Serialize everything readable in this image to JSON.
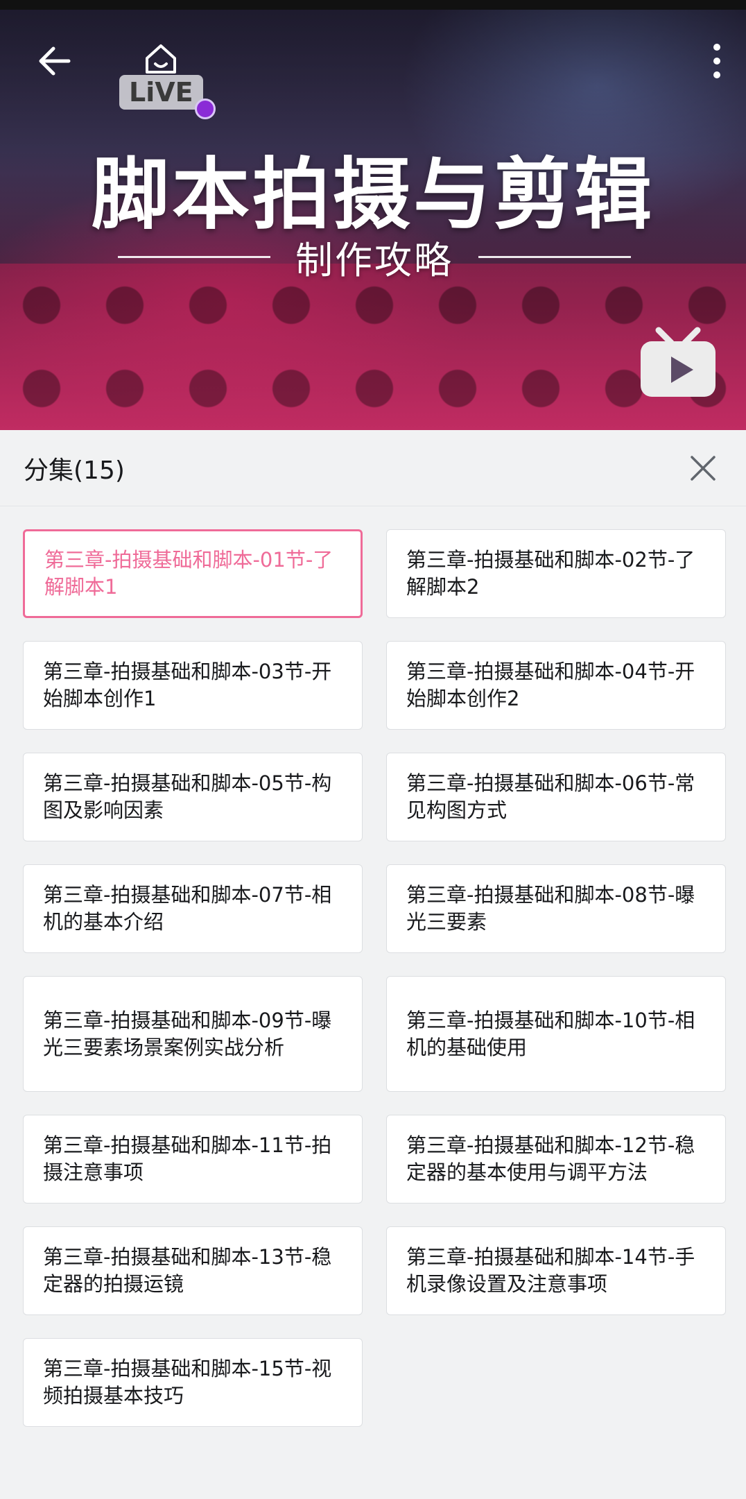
{
  "video": {
    "live_badge": "LiVE",
    "title": "脚本拍摄与剪辑",
    "subtitle": "制作攻略"
  },
  "icons": {
    "back": "arrow-left-icon",
    "more": "more-vertical-icon",
    "home": "home-icon",
    "tv": "bilibili-tv-icon",
    "close": "close-icon"
  },
  "colors": {
    "active": "#ef6b98",
    "text": "#18191c",
    "panel_bg": "#f1f2f3"
  },
  "panel": {
    "title": "分集(15)"
  },
  "episodes": [
    {
      "label": "第三章-拍摄基础和脚本-01节-了解脚本1",
      "active": true
    },
    {
      "label": "第三章-拍摄基础和脚本-02节-了解脚本2"
    },
    {
      "label": "第三章-拍摄基础和脚本-03节-开始脚本创作1"
    },
    {
      "label": "第三章-拍摄基础和脚本-04节-开始脚本创作2"
    },
    {
      "label": "第三章-拍摄基础和脚本-05节-构图及影响因素"
    },
    {
      "label": "第三章-拍摄基础和脚本-06节-常见构图方式"
    },
    {
      "label": "第三章-拍摄基础和脚本-07节-相机的基本介绍"
    },
    {
      "label": "第三章-拍摄基础和脚本-08节-曝光三要素"
    },
    {
      "label": "第三章-拍摄基础和脚本-09节-曝光三要素场景案例实战分析"
    },
    {
      "label": "第三章-拍摄基础和脚本-10节-相机的基础使用"
    },
    {
      "label": "第三章-拍摄基础和脚本-11节-拍摄注意事项"
    },
    {
      "label": "第三章-拍摄基础和脚本-12节-稳定器的基本使用与调平方法"
    },
    {
      "label": "第三章-拍摄基础和脚本-13节-稳定器的拍摄运镜"
    },
    {
      "label": "第三章-拍摄基础和脚本-14节-手机录像设置及注意事项"
    },
    {
      "label": "第三章-拍摄基础和脚本-15节-视频拍摄基本技巧"
    }
  ]
}
